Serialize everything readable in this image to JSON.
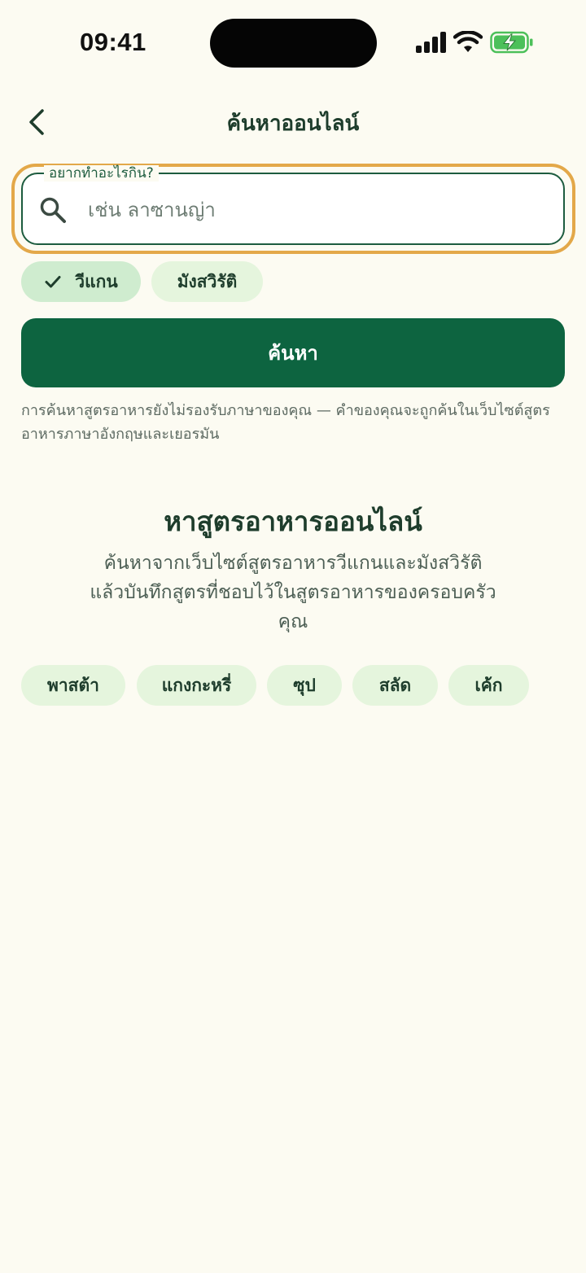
{
  "status_bar": {
    "time": "09:41",
    "icons": [
      "cellular-signal-icon",
      "wifi-icon",
      "battery-charging-icon"
    ],
    "battery_color": "#4cc05a"
  },
  "header": {
    "back_icon": "chevron-left-icon",
    "title": "ค้นหาออนไลน์"
  },
  "search": {
    "label": "อยากทำอะไรกิน?",
    "placeholder": "เช่น ลาซานญ่า",
    "value": "",
    "icon": "search-icon",
    "focus_color": "#e3a849",
    "border_color": "#1d5c3f"
  },
  "filters": [
    {
      "label": "วีแกน",
      "selected": true,
      "icon": "check-icon"
    },
    {
      "label": "มังสวิรัติ",
      "selected": false
    }
  ],
  "search_button": {
    "label": "ค้นหา",
    "color": "#0d6440"
  },
  "notice": "การค้นหาสูตรอาหารยังไม่รองรับภาษาของคุณ — คำของคุณจะถูกค้นในเว็บไซต์สูตรอาหารภาษาอังกฤษและเยอรมัน",
  "empty_state": {
    "title": "หาสูตรอาหารออนไลน์",
    "subtitle": "ค้นหาจากเว็บไซต์สูตรอาหารวีแกนและมังสวิรัติ แล้วบันทึกสูตรที่ชอบไว้ในสูตรอาหารของครอบครัวคุณ"
  },
  "suggestions": [
    "พาสต้า",
    "แกงกะหรี่",
    "ซุป",
    "สลัด",
    "เค้ก"
  ]
}
